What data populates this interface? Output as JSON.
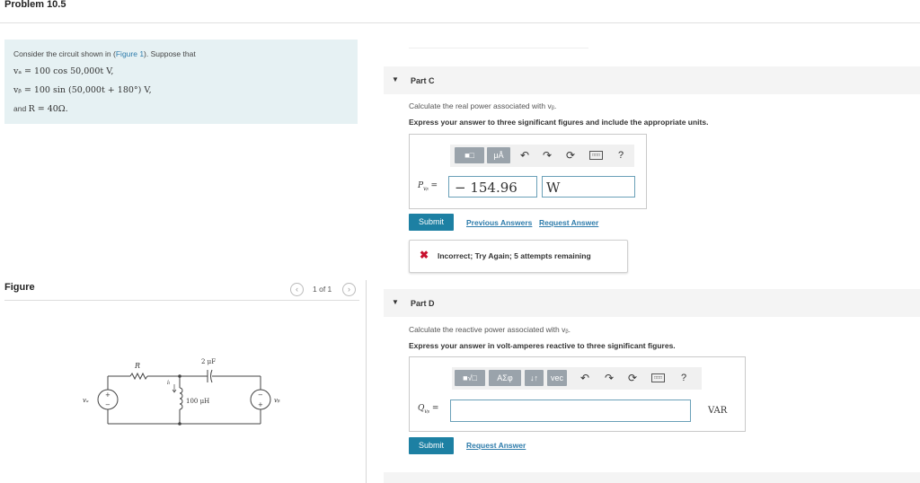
{
  "header": {
    "title": "Problem 10.5"
  },
  "problem": {
    "intro_prefix": "Consider the circuit shown in (",
    "figure_link": "Figure 1",
    "intro_suffix": "). Suppose that",
    "va_eq": "vₐ = 100 cos 50,000t V,",
    "vb_eq": "vᵦ = 100 sin (50,000t + 180°) V,",
    "r_line_prefix": "and",
    "r_eq": "R = 40Ω."
  },
  "figure": {
    "label": "Figure",
    "pager_text": "1 of 1",
    "prev_icon": "chevron-left-icon",
    "next_icon": "chevron-right-icon",
    "circuit": {
      "resistor_label": "R",
      "capacitor_label": "2 μF",
      "inductor_label": "100 μH",
      "current_label": "iₗ",
      "source_a_label": "vₐ",
      "source_b_label": "vᵦ",
      "plus": "+",
      "minus": "−"
    }
  },
  "partC": {
    "title": "Part C",
    "question": "Calculate the real power associated with vᵦ.",
    "instruction": "Express your answer to three significant figures and include the appropriate units.",
    "toolbar_buttons": [
      "■□",
      "μÅ"
    ],
    "toolbar_icons": [
      "undo-icon",
      "redo-icon",
      "reset-icon",
      "keyboard-icon",
      "help-icon"
    ],
    "help_text": "?",
    "var_label": "P",
    "var_sub": "vᵦ",
    "equals": "=",
    "value": "− 154.96",
    "unit": "W",
    "submit_label": "Submit",
    "previous_answers_label": "Previous Answers",
    "request_answer_label": "Request Answer",
    "feedback": "Incorrect; Try Again; 5 attempts remaining"
  },
  "partD": {
    "title": "Part D",
    "question": "Calculate the reactive power associated with vᵦ.",
    "instruction": "Express your answer in volt-amperes reactive to three significant figures.",
    "toolbar_buttons": [
      "■√□",
      "ΑΣφ",
      "↓↑",
      "vec"
    ],
    "toolbar_icons": [
      "undo-icon",
      "redo-icon",
      "reset-icon",
      "keyboard-icon",
      "help-icon"
    ],
    "help_text": "?",
    "var_label": "Q",
    "var_sub": "vᵦ",
    "equals": "=",
    "value": "",
    "unit": "VAR",
    "submit_label": "Submit",
    "request_answer_label": "Request Answer"
  },
  "colors": {
    "panel_bg": "#e6f1f3",
    "link": "#2e7cab",
    "submit_bg": "#1d80a3",
    "error_icon": "#c8102e",
    "toolbar_button": "#9aa3ab"
  }
}
